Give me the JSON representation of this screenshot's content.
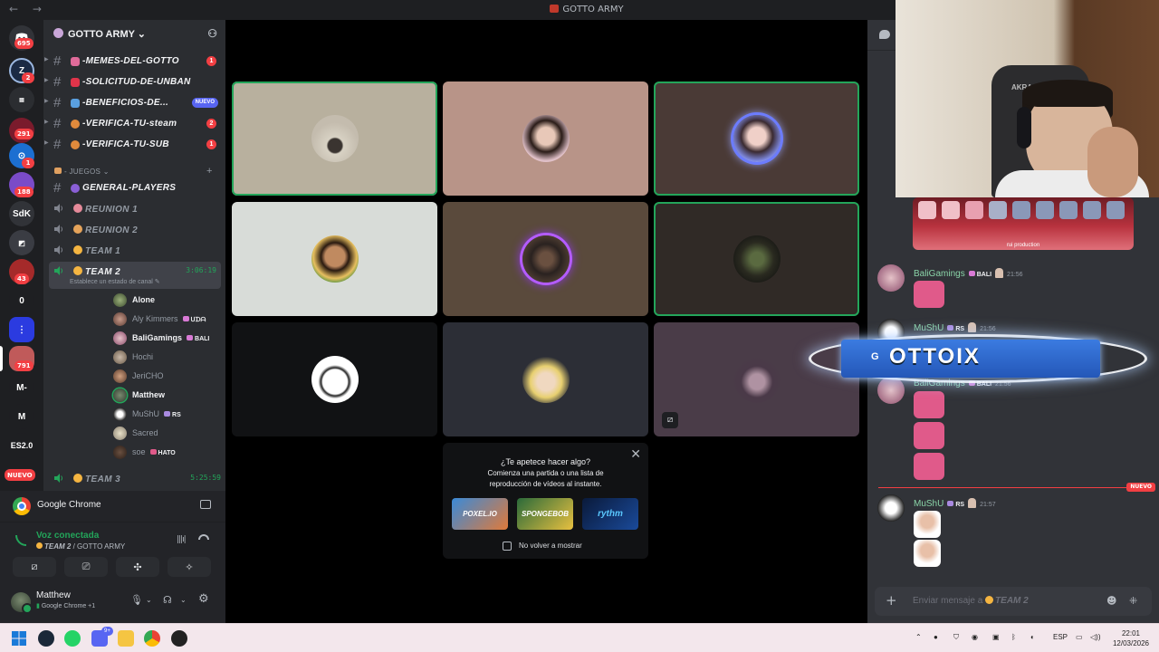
{
  "titlebar": {
    "title": "GOTTO ARMY",
    "nav": "← →"
  },
  "rail": {
    "badges": [
      "695",
      "2",
      "291",
      "1",
      "188",
      "43",
      "791"
    ],
    "labels": [
      "SdK",
      "0",
      "M-",
      "M",
      "ES2.0"
    ],
    "new_badge": "NUEVO"
  },
  "guild": {
    "name": "GOTTO ARMY ⌄"
  },
  "channels": [
    {
      "name": "-MEMES-DEL-GOTTO",
      "count": "1"
    },
    {
      "name": "-SOLICITUD-DE-UNBAN"
    },
    {
      "name": "-BENEFICIOS-DE...",
      "badge": "NUEVO"
    },
    {
      "name": "-VERIFICA-TU-steam",
      "count": "2"
    },
    {
      "name": "-VERIFICA-TU-SUB",
      "count": "1"
    }
  ],
  "category": {
    "label": "- JUEGOS ⌄",
    "plus": "+"
  },
  "general_channel": {
    "name": "GENERAL-PLAYERS"
  },
  "voice_channels": [
    {
      "name": "REUNION 1"
    },
    {
      "name": "REUNION 2"
    },
    {
      "name": "TEAM 1"
    }
  ],
  "active_voice": {
    "name": "TEAM 2",
    "timer": "3:06:19",
    "status": "Establece un estado de canal ✎"
  },
  "members": [
    {
      "name": "Alone",
      "bold": true,
      "tag": ""
    },
    {
      "name": "Aly Kimmers",
      "bold": false,
      "tag": "ᑌᗪᗩ"
    },
    {
      "name": "BaliGamings",
      "bold": true,
      "tag": "BALI"
    },
    {
      "name": "Hochi",
      "bold": false,
      "tag": ""
    },
    {
      "name": "JeriCHO",
      "bold": false,
      "tag": ""
    },
    {
      "name": "Matthew",
      "bold": true,
      "tag": ""
    },
    {
      "name": "MuShU",
      "bold": false,
      "tag": "RS"
    },
    {
      "name": "Sacred",
      "bold": false,
      "tag": ""
    },
    {
      "name": "soe",
      "bold": false,
      "tag": "HATO"
    }
  ],
  "next_voice": {
    "name": "TEAM 3",
    "timer": "5:25:59"
  },
  "app_row": {
    "label": "Google Chrome"
  },
  "voice_status": {
    "title": "Voz conectada",
    "channel": "TEAM 2",
    "guild": " / GOTTO ARMY"
  },
  "user": {
    "name": "Matthew",
    "status": "Google Chrome +1"
  },
  "activity_prompt": {
    "title": "¿Te apetece hacer algo?",
    "line1": "Comienza una partida o una lista de",
    "line2": "reproducción de vídeos al instante.",
    "games": [
      "POXEL.IO",
      "SPONGEBOB",
      "rythm"
    ],
    "checkbox_label": "No volver a mostrar"
  },
  "chat": {
    "messages": [
      {
        "author": "BaliGamings",
        "tag": "BALI",
        "time": "21:56"
      },
      {
        "author": "MuShU",
        "tag": "RS",
        "time": "21:56"
      },
      {
        "author": "BaliGamings",
        "tag": "BALI",
        "time": "21:56"
      },
      {
        "author": "MuShU",
        "tag": "RS",
        "time": "21:57"
      }
    ],
    "new_divider": "NUEVO",
    "placeholder_prefix": "Enviar mensaje a ",
    "placeholder_channel": "TEAM 2",
    "emote_caption": "rui production"
  },
  "overlay": {
    "g": "G",
    "text": "OTTOIX"
  },
  "webcam": {
    "brand": "AKRACING"
  },
  "taskbar": {
    "language": "ESP",
    "time": "22:01",
    "date": "12/03/2026",
    "discord_badge": "9+"
  },
  "colors": {
    "green": "#23a55a",
    "red": "#f23f43",
    "blurple": "#5865f2"
  }
}
